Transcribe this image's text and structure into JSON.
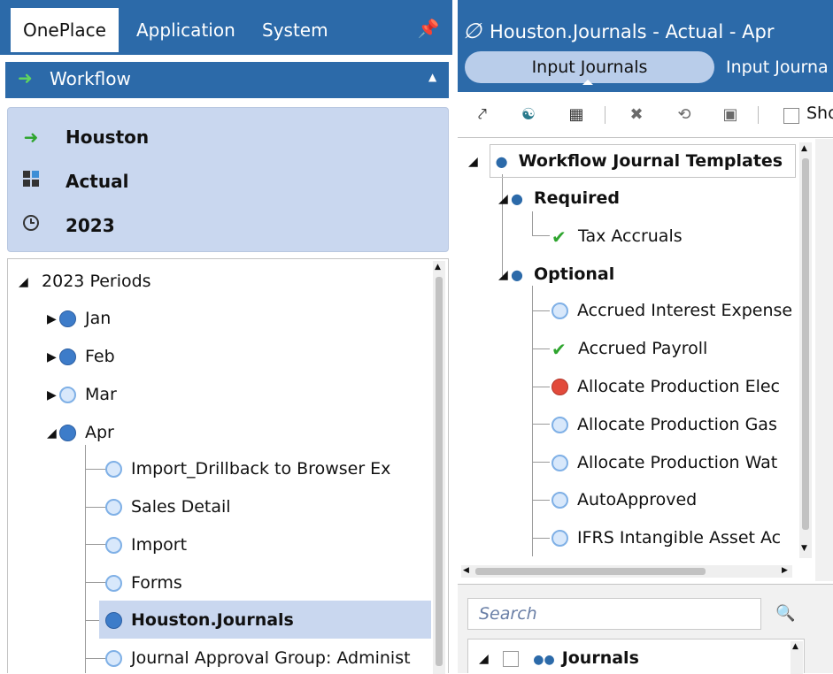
{
  "tabs": [
    "OnePlace",
    "Application",
    "System"
  ],
  "workflow_bar": {
    "label": "Workflow"
  },
  "context": {
    "entity": "Houston",
    "scenario": "Actual",
    "time": "2023"
  },
  "period_tree": {
    "root": "2023 Periods",
    "months": [
      {
        "label": "Jan",
        "state": "filled",
        "expander": "right"
      },
      {
        "label": "Feb",
        "state": "filled",
        "expander": "right"
      },
      {
        "label": "Mar",
        "state": "empty",
        "expander": "right"
      },
      {
        "label": "Apr",
        "state": "filled",
        "expander": "down"
      }
    ],
    "apr_children": [
      {
        "label": "Import_Drillback to Browser Ex",
        "state": "empty"
      },
      {
        "label": "Sales Detail",
        "state": "empty"
      },
      {
        "label": "Import",
        "state": "empty"
      },
      {
        "label": "Forms",
        "state": "empty"
      },
      {
        "label": "Houston.Journals",
        "state": "filled",
        "selected": true
      },
      {
        "label": "Journal Approval Group:  Administ",
        "state": "empty"
      }
    ]
  },
  "right_header": {
    "title": "Houston.Journals - Actual - Apr",
    "tabs": [
      "Input Journals",
      "Input Journa"
    ]
  },
  "toolbar": {
    "show_label": "Sho"
  },
  "journal_tree": {
    "root": "Workflow Journal Templates",
    "required_label": "Required",
    "required_items": [
      {
        "label": "Tax Accruals",
        "status": "check"
      }
    ],
    "optional_label": "Optional",
    "optional_items": [
      {
        "label": "Accrued Interest Expense",
        "status": "empty"
      },
      {
        "label": "Accrued Payroll",
        "status": "check"
      },
      {
        "label": "Allocate Production Elec",
        "status": "red"
      },
      {
        "label": "Allocate Production Gas",
        "status": "empty"
      },
      {
        "label": "Allocate Production Wat",
        "status": "empty"
      },
      {
        "label": "AutoApproved",
        "status": "empty"
      },
      {
        "label": "IFRS Intangible Asset Ac",
        "status": "empty"
      }
    ]
  },
  "lower": {
    "search_placeholder": "Search",
    "journals_label": "Journals"
  },
  "colors": {
    "brand_blue": "#2c6aa9",
    "context_bg": "#c9d7ef",
    "selected_bg": "#c9d7ef",
    "check_green": "#2fa52f",
    "error_red": "#e24a3b"
  }
}
